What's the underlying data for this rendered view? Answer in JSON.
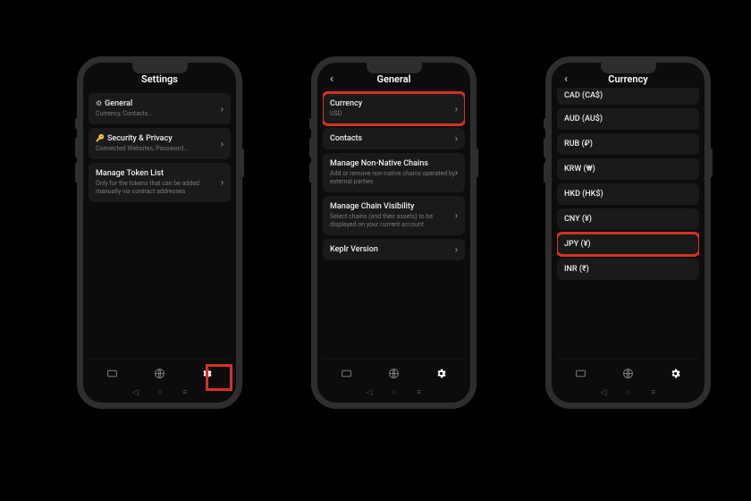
{
  "phones": {
    "settings": {
      "title": "Settings",
      "rows": [
        {
          "icon": "⚙",
          "title": "General",
          "sub": "Currency, Contacts..."
        },
        {
          "icon": "🔑",
          "title": "Security & Privacy",
          "sub": "Connected Websites, Password..."
        },
        {
          "icon": "",
          "title": "Manage Token List",
          "sub": "Only for the tokens that can be added manually via contract addresses"
        }
      ]
    },
    "general": {
      "title": "General",
      "rows": [
        {
          "title": "Currency",
          "sub": "USD"
        },
        {
          "title": "Contacts",
          "sub": ""
        },
        {
          "title": "Manage Non-Native Chains",
          "sub": "Add or remove non-native chains operated by external parties"
        },
        {
          "title": "Manage Chain Visibility",
          "sub": "Select chains (and their assets) to be displayed on your current account"
        },
        {
          "title": "Keplr Version",
          "sub": ""
        }
      ]
    },
    "currency": {
      "title": "Currency",
      "rows": [
        {
          "title": "CAD (CA$)"
        },
        {
          "title": "AUD (AU$)"
        },
        {
          "title": "RUB (₽)"
        },
        {
          "title": "KRW (₩)"
        },
        {
          "title": "HKD (HK$)"
        },
        {
          "title": "CNY (¥)"
        },
        {
          "title": "JPY (¥)"
        },
        {
          "title": "INR (₹)"
        }
      ]
    }
  }
}
